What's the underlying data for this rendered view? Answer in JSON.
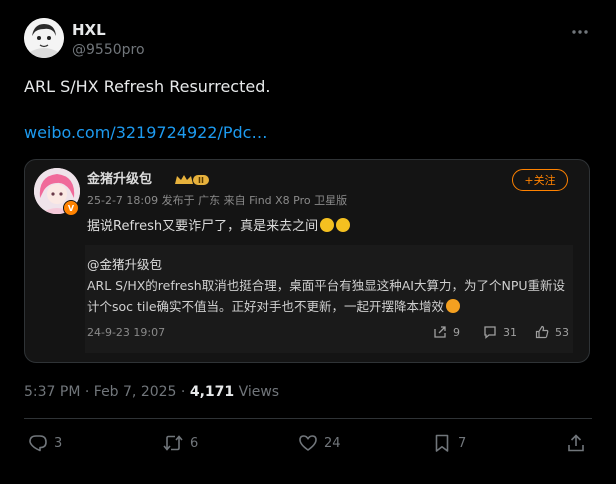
{
  "tweet": {
    "author_name": "HXL",
    "author_handle": "@9550pro",
    "text": "ARL S/HX Refresh Resurrected.",
    "link": "weibo.com/3219724922/Pdc…"
  },
  "card": {
    "name": "金猪升级包",
    "rank_label": "II",
    "meta": "25-2-7 18:09 发布于 广东 来自 Find X8 Pro 卫星版",
    "follow_label": "+关注",
    "body": "据说Refresh又要诈尸了，真是来去之间",
    "quote": {
      "mention": "@金猪升级包",
      "line1": "ARL S/HX的refresh取消也挺合理，桌面平台有独显这种AI大算力，为了个NPU重新设",
      "line2": "计个soc tile确实不值当。正好对手也不更新，一起开摆降本增效",
      "date": "24-9-23 19:07",
      "reposts": "9",
      "comments": "31",
      "likes": "53"
    }
  },
  "meta": {
    "time": "5:37 PM",
    "separator": " · ",
    "date": "Feb 7, 2025",
    "views_count": "4,171",
    "views_label": " Views"
  },
  "actions": {
    "replies": "3",
    "reposts": "6",
    "likes": "24",
    "bookmarks": "7"
  },
  "colors": {
    "background": "#000000",
    "text": "#e7e9ea",
    "muted": "#71767b",
    "link": "#1d9bf0",
    "weibo_accent": "#ff8200",
    "border": "#2f3336"
  },
  "icons": [
    "more-icon",
    "verified-icon",
    "follow-icon",
    "repost-icon",
    "comment-icon",
    "like-icon",
    "reply-icon",
    "retweet-icon",
    "heart-icon",
    "bookmark-icon",
    "share-icon"
  ]
}
